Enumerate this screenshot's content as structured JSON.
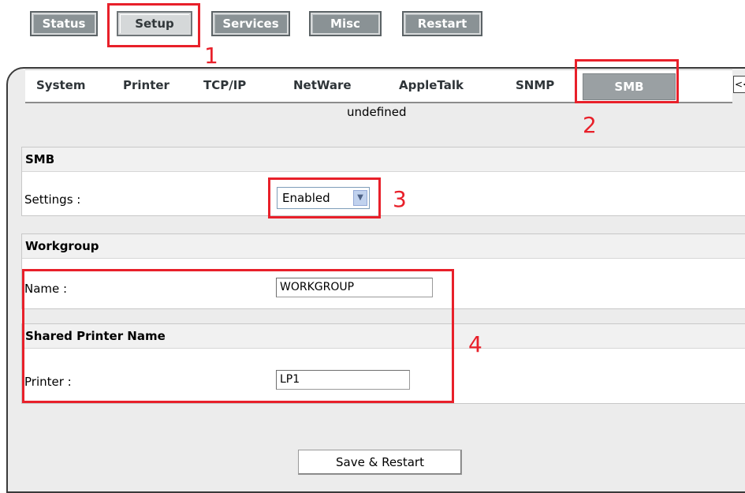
{
  "topnav": {
    "status": "Status",
    "setup": "Setup",
    "services": "Services",
    "misc": "Misc",
    "restart": "Restart"
  },
  "tabs": {
    "system": "System",
    "printer": "Printer",
    "tcpip": "TCP/IP",
    "netware": "NetWare",
    "appletalk": "AppleTalk",
    "snmp": "SNMP",
    "smb": "SMB",
    "collapse": "<<"
  },
  "status_text": "undefined",
  "smb": {
    "heading": "SMB",
    "settings_label": "Settings :",
    "settings_value": "Enabled"
  },
  "workgroup": {
    "heading": "Workgroup",
    "name_label": "Name :",
    "name_value": "WORKGROUP"
  },
  "shared_printer": {
    "heading": "Shared Printer Name",
    "printer_label": "Printer :",
    "printer_value": "LP1"
  },
  "save_button": "Save & Restart",
  "annotations": {
    "n1": "1",
    "n2": "2",
    "n3": "3",
    "n4": "4"
  },
  "colors": {
    "annotation_red": "#e8202a",
    "tab_active": "#9aa0a3"
  }
}
